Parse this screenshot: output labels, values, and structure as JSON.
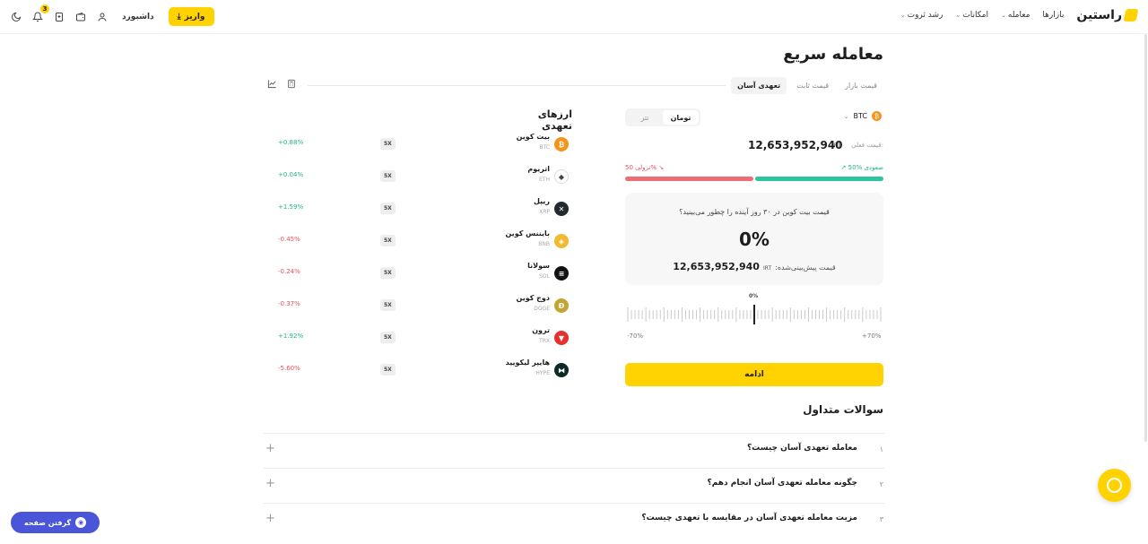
{
  "topbar": {
    "logo": "راستین",
    "nav": [
      {
        "label": "بازارها",
        "has_chevron": false
      },
      {
        "label": "معامله",
        "has_chevron": true
      },
      {
        "label": "امکانات",
        "has_chevron": true
      },
      {
        "label": "رشد ثروت",
        "has_chevron": true
      }
    ],
    "dashboard": "داشبورد",
    "deposit": "واریز",
    "notif_count": "3"
  },
  "page": {
    "title": "معامله سریع",
    "tabs": [
      "قیمت بازار",
      "قیمت ثابت",
      "تعهدی آسان"
    ],
    "active_tab": 2
  },
  "trade": {
    "coin_symbol": "BTC",
    "currency_options": [
      "تومان",
      "تتر"
    ],
    "current_price_label": "قیمت فعلی:",
    "currency_unit": "IRT",
    "current_price": "12,653,952,940",
    "up_label": "50% صعودی",
    "down_label": "نزولی 50%",
    "up_ratio": 0.5,
    "question": "قیمت بیت کوین در ۳۰ روز آینده را چطور می‌بینید؟",
    "predicted_pct": "0%",
    "predicted_label": "قیمت پیش‌بینی‌شده:",
    "predicted_price": "12,653,952,940",
    "slider_value": "0%",
    "slider_min": "-70%",
    "slider_max": "+70%",
    "continue": "ادامه"
  },
  "assets": {
    "title": "ارزهای تعهدی",
    "items": [
      {
        "name": "بیت کوین",
        "symbol": "BTC",
        "leverage": "5X",
        "change": "+0.88%",
        "dir": "pos",
        "color": "#f7931a",
        "glyph": "₿",
        "icon": "bitcoin-icon"
      },
      {
        "name": "اتریوم",
        "symbol": "ETH",
        "leverage": "5X",
        "change": "+0.04%",
        "dir": "pos",
        "color": "#ffffff",
        "glyph": "◆",
        "icon": "ethereum-icon"
      },
      {
        "name": "ریپل",
        "symbol": "XRP",
        "leverage": "5X",
        "change": "+1.59%",
        "dir": "pos",
        "color": "#23292f",
        "glyph": "✕",
        "icon": "ripple-icon"
      },
      {
        "name": "بایننس کوین",
        "symbol": "BNB",
        "leverage": "5X",
        "change": "-0.45%",
        "dir": "neg",
        "color": "#f3ba2f",
        "glyph": "◈",
        "icon": "bnb-icon"
      },
      {
        "name": "سولانا",
        "symbol": "SOL",
        "leverage": "5X",
        "change": "-0.24%",
        "dir": "neg",
        "color": "#111111",
        "glyph": "≡",
        "icon": "solana-icon"
      },
      {
        "name": "دوج کوین",
        "symbol": "DOGE",
        "leverage": "5X",
        "change": "-0.37%",
        "dir": "neg",
        "color": "#c2a633",
        "glyph": "Ð",
        "icon": "dogecoin-icon"
      },
      {
        "name": "ترون",
        "symbol": "TRX",
        "leverage": "5X",
        "change": "+1.92%",
        "dir": "pos",
        "color": "#e5312b",
        "glyph": "▼",
        "icon": "tron-icon"
      },
      {
        "name": "هایپر لیکویید",
        "symbol": "HYPE",
        "leverage": "5X",
        "change": "-5.60%",
        "dir": "neg",
        "color": "#0b2a26",
        "glyph": "⧓",
        "icon": "hyperliquid-icon"
      }
    ]
  },
  "faq": {
    "title": "سوالات متداول",
    "items": [
      {
        "num": "۱",
        "q": "معامله تعهدی آسان چیست؟"
      },
      {
        "num": "۲",
        "q": "چگونه معامله تعهدی آسان انجام دهم؟"
      },
      {
        "num": "۳",
        "q": "مزیت معامله تعهدی آسان در مقایسه با تعهدی چیست؟"
      }
    ]
  },
  "capture_button": "گرفتن صفحه",
  "colors": {
    "accent": "#ffd200",
    "up": "#1fb48a",
    "down": "#e8505b",
    "capture": "#4a55d8"
  }
}
